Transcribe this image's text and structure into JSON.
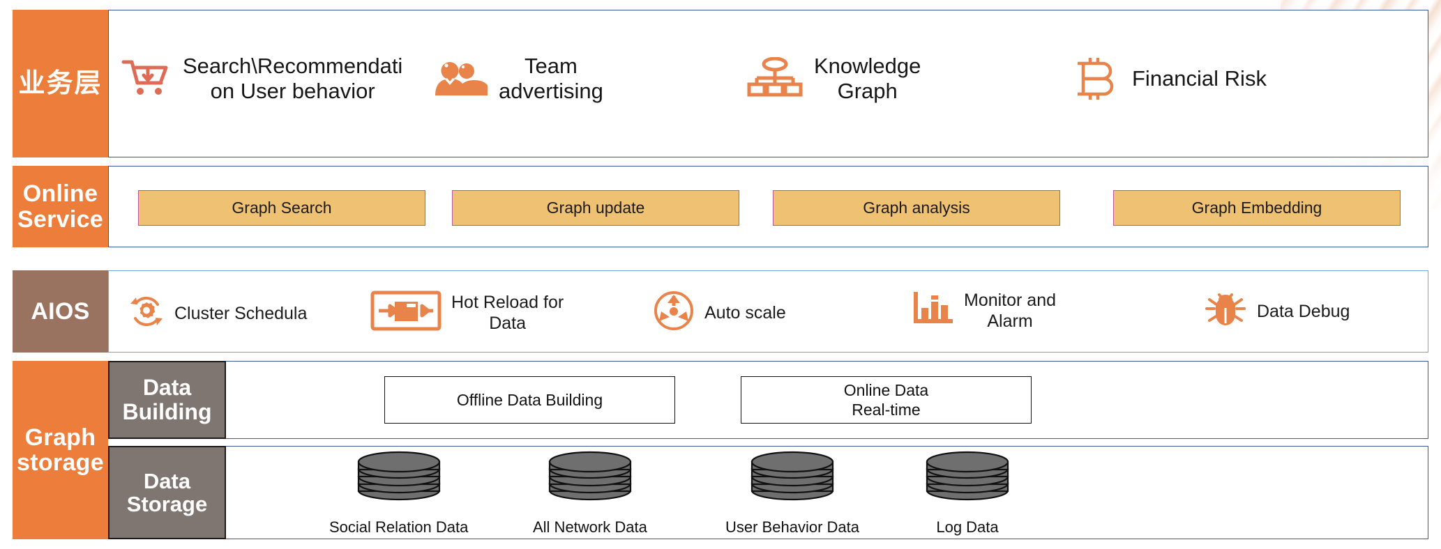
{
  "theme": {
    "orange": "#ED7D3A",
    "brown": "#9A7360",
    "gray_tag": "#7F7672",
    "service_fill": "#EFC173",
    "service_border": "#B9569B",
    "panel_border": "#3B5998",
    "icon_orange": "#E88A50",
    "cart_icon": "#DE6B55"
  },
  "rows": {
    "business": {
      "label": "业务层",
      "items": [
        {
          "icon": "shopping-cart-icon",
          "text": "Search\\Recommendati\non  User behavior"
        },
        {
          "icon": "team-people-icon",
          "text": "Team\nadvertising"
        },
        {
          "icon": "knowledge-graph-hierarchy-icon",
          "text": "Knowledge\nGraph"
        },
        {
          "icon": "bitcoin-icon",
          "text": "Financial Risk"
        }
      ]
    },
    "online_service": {
      "label": "Online\nService",
      "items": [
        {
          "label": "Graph Search"
        },
        {
          "label": "Graph update"
        },
        {
          "label": "Graph analysis"
        },
        {
          "label": "Graph Embedding"
        }
      ]
    },
    "aios": {
      "label": "AIOS",
      "items": [
        {
          "icon": "gear-refresh-icon",
          "text": "Cluster Schedula"
        },
        {
          "icon": "hot-reload-icon",
          "text": "Hot Reload for\nData"
        },
        {
          "icon": "auto-scale-arrows-icon",
          "text": "Auto scale"
        },
        {
          "icon": "bar-chart-icon",
          "text": "Monitor and\nAlarm"
        },
        {
          "icon": "bug-icon",
          "text": "Data Debug"
        }
      ]
    },
    "graph_storage": {
      "label": "Graph\nstorage",
      "data_building": {
        "tag": "Data\nBuilding",
        "boxes": [
          {
            "label": "Offline Data Building"
          },
          {
            "label": "Online Data\nReal-time"
          }
        ]
      },
      "data_storage": {
        "tag": "Data Storage",
        "databases": [
          {
            "icon": "database-cylinder-icon",
            "caption": "Social Relation Data"
          },
          {
            "icon": "database-cylinder-icon",
            "caption": "All Network Data"
          },
          {
            "icon": "database-cylinder-icon",
            "caption": "User Behavior Data"
          },
          {
            "icon": "database-cylinder-icon",
            "caption": "Log Data"
          }
        ]
      }
    }
  }
}
